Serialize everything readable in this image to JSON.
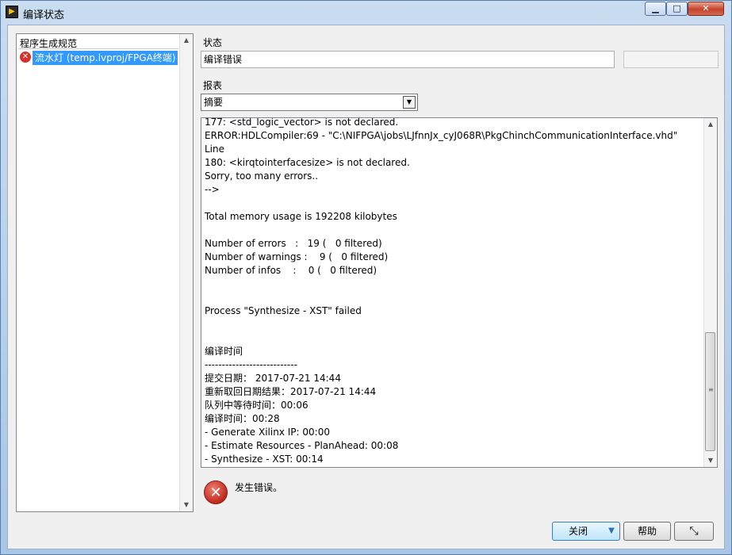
{
  "window": {
    "title": "编译状态",
    "app_icon": "labview-icon",
    "controls": {
      "minimize": "▁",
      "maximize": "□",
      "close": "✕"
    }
  },
  "spec_list": {
    "header": "程序生成规范",
    "items": [
      {
        "label": "流水灯 (temp.lvproj/FPGA终端)",
        "status_icon": "error-icon",
        "selected": true
      }
    ]
  },
  "status": {
    "label": "状态",
    "value": "编译错误"
  },
  "report": {
    "label": "报表",
    "selected": "摘要"
  },
  "log": {
    "lines": [
      "177: <std_logic_vector> is not declared.",
      "ERROR:HDLCompiler:69 - \"C:\\NIFPGA\\jobs\\LJfnnJx_cyJ068R\\PkgChinchCommunicationInterface.vhd\" Line",
      "180: <kirqtointerfacesize> is not declared.",
      "Sorry, too many errors..",
      "-->",
      "",
      "Total memory usage is 192208 kilobytes",
      "",
      "Number of errors   :   19 (   0 filtered)",
      "Number of warnings :    9 (   0 filtered)",
      "Number of infos    :    0 (   0 filtered)",
      "",
      "",
      "Process \"Synthesize - XST\" failed",
      "",
      "",
      "编译时间",
      "---------------------------",
      "提交日期： 2017-07-21 14:44",
      "重新取回日期结果：2017-07-21 14:44",
      "队列中等待时间：00:06",
      "编译时间：00:28",
      "- Generate Xilinx IP: 00:00",
      "- Estimate Resources - PlanAhead: 00:08",
      "- Synthesize - XST: 00:14"
    ]
  },
  "message": {
    "icon": "error-icon",
    "text": "发生错误。"
  },
  "buttons": {
    "close": "关闭",
    "help": "帮助",
    "resize_icon": "resize-icon"
  },
  "colors": {
    "selection": "#3399ff",
    "error": "#d7322a"
  }
}
